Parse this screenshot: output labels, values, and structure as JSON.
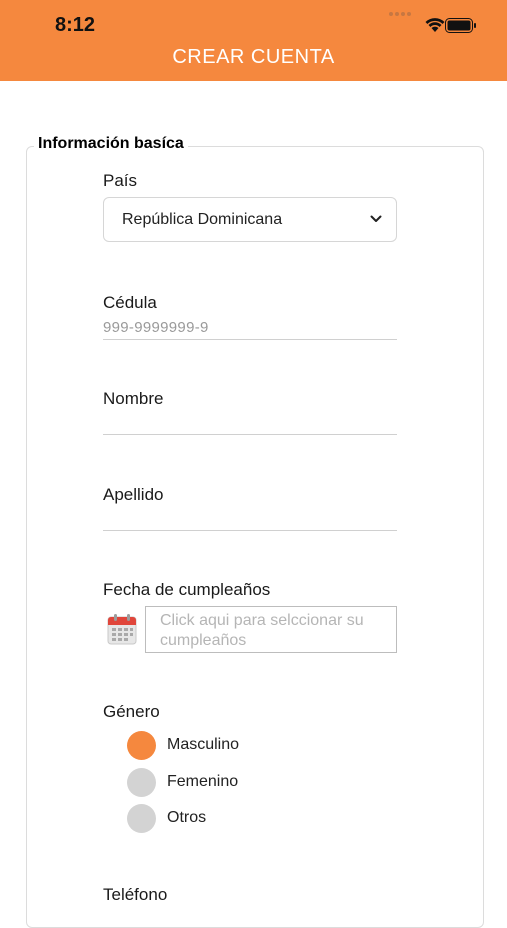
{
  "status_bar": {
    "time": "8:12"
  },
  "header": {
    "title": "CREAR CUENTA"
  },
  "form": {
    "section_title": "Información basíca",
    "country": {
      "label": "País",
      "value": "República Dominicana"
    },
    "cedula": {
      "label": "Cédula",
      "placeholder": "999-9999999-9"
    },
    "nombre": {
      "label": "Nombre",
      "value": ""
    },
    "apellido": {
      "label": "Apellido",
      "value": ""
    },
    "birthday": {
      "label": "Fecha de cumpleaños",
      "placeholder": "Click aqui para selccionar su cumpleaños"
    },
    "gender": {
      "label": "Género",
      "options": [
        {
          "label": "Masculino",
          "selected": true
        },
        {
          "label": "Femenino",
          "selected": false
        },
        {
          "label": "Otros",
          "selected": false
        }
      ]
    },
    "phone": {
      "label": "Teléfono"
    }
  },
  "colors": {
    "accent": "#f5883e",
    "radio_unselected": "#d3d3d3"
  }
}
